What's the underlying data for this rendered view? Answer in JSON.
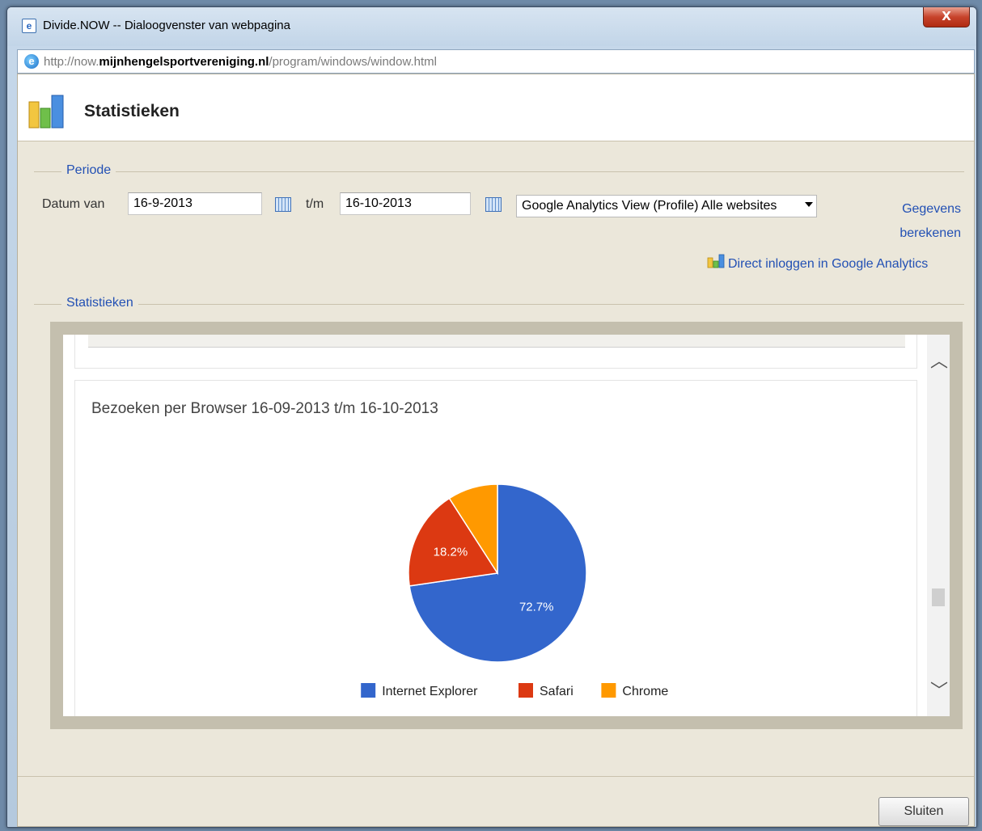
{
  "window": {
    "title": "Divide.NOW -- Dialoogvenster van webpagina",
    "close_label": "X",
    "url_prefix": "http://now.",
    "url_domain": "mijnhengelsportvereniging.nl",
    "url_path": "/program/windows/window.html"
  },
  "header": {
    "title": "Statistieken"
  },
  "periode": {
    "legend": "Periode",
    "from_label": "Datum van",
    "from_value": "16-9-2013",
    "to_label": "t/m",
    "to_value": "16-10-2013",
    "profile_select": "Google Analytics View (Profile) Alle websites",
    "calc_link_line1": "Gegevens",
    "calc_link_line2": "berekenen",
    "ga_link": "Direct inloggen in Google Analytics"
  },
  "stats": {
    "legend": "Statistieken"
  },
  "chart_data": {
    "type": "pie",
    "title": "Bezoeken per Browser 16-09-2013 t/m 16-10-2013",
    "categories": [
      "Internet Explorer",
      "Safari",
      "Chrome"
    ],
    "values": [
      72.7,
      18.2,
      9.1
    ],
    "labels": [
      "72.7%",
      "18.2%",
      ""
    ],
    "colors": [
      "#3366cc",
      "#dc3912",
      "#ff9900"
    ],
    "legend_position": "bottom"
  },
  "footer": {
    "close_button": "Sluiten"
  }
}
